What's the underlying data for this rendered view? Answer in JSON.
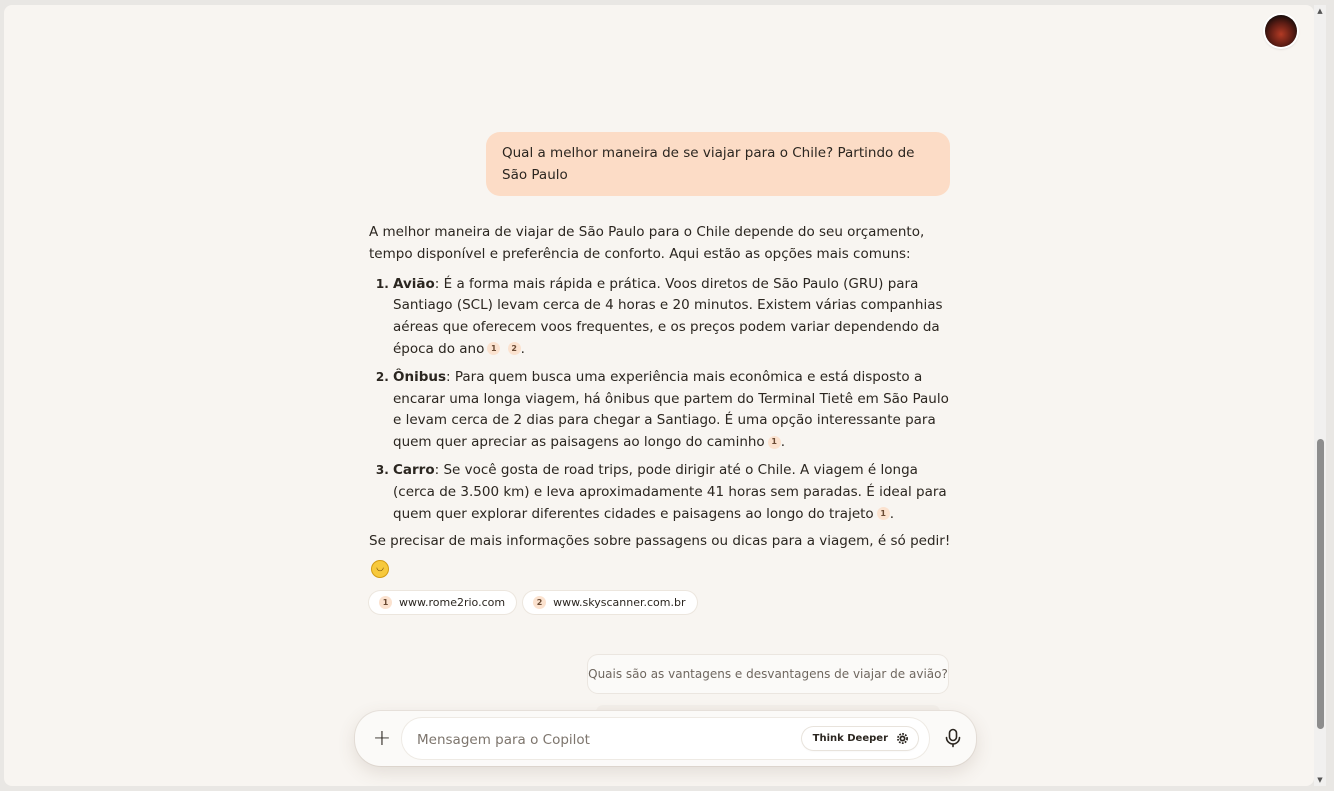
{
  "user_message": "Qual a melhor maneira de se viajar para o Chile? Partindo de São Paulo",
  "answer": {
    "intro": "A melhor maneira de viajar de São Paulo para o Chile depende do seu orçamento, tempo disponível e preferência de conforto. Aqui estão as opções mais comuns:",
    "items": [
      {
        "title": "Avião",
        "text": ": É a forma mais rápida e prática. Voos diretos de São Paulo (GRU) para Santiago (SCL) levam cerca de 4 horas e 20 minutos. Existem várias companhias aéreas que oferecem voos frequentes, e os preços podem variar dependendo da época do ano",
        "citations": [
          "1",
          "2"
        ]
      },
      {
        "title": "Ônibus",
        "text": ": Para quem busca uma experiência mais econômica e está disposto a encarar uma longa viagem, há ônibus que partem do Terminal Tietê em São Paulo e levam cerca de 2 dias para chegar a Santiago. É uma opção interessante para quem quer apreciar as paisagens ao longo do caminho",
        "citations": [
          "1"
        ]
      },
      {
        "title": "Carro",
        "text": ": Se você gosta de road trips, pode dirigir até o Chile. A viagem é longa (cerca de 3.500 km) e leva aproximadamente 41 horas sem paradas. É ideal para quem quer explorar diferentes cidades e paisagens ao longo do trajeto",
        "citations": [
          "1"
        ]
      }
    ],
    "outro": "Se precisar de mais informações sobre passagens ou dicas para a viagem, é só pedir!",
    "period": ".",
    "emoji": "smiling-face-emoji"
  },
  "sources": [
    {
      "num": "1",
      "label": "www.rome2rio.com"
    },
    {
      "num": "2",
      "label": "www.skyscanner.com.br"
    }
  ],
  "suggestion": "Quais são as vantagens e desvantagens de viajar de avião?",
  "composer": {
    "placeholder": "Mensagem para o Copilot",
    "think_label": "Think Deeper",
    "plus_icon": "plus-icon",
    "mic_icon": "microphone-icon"
  },
  "colors": {
    "user_bubble": "#fcdcc6",
    "citation_badge": "#fbe2cf",
    "background": "#f8f5f1"
  }
}
